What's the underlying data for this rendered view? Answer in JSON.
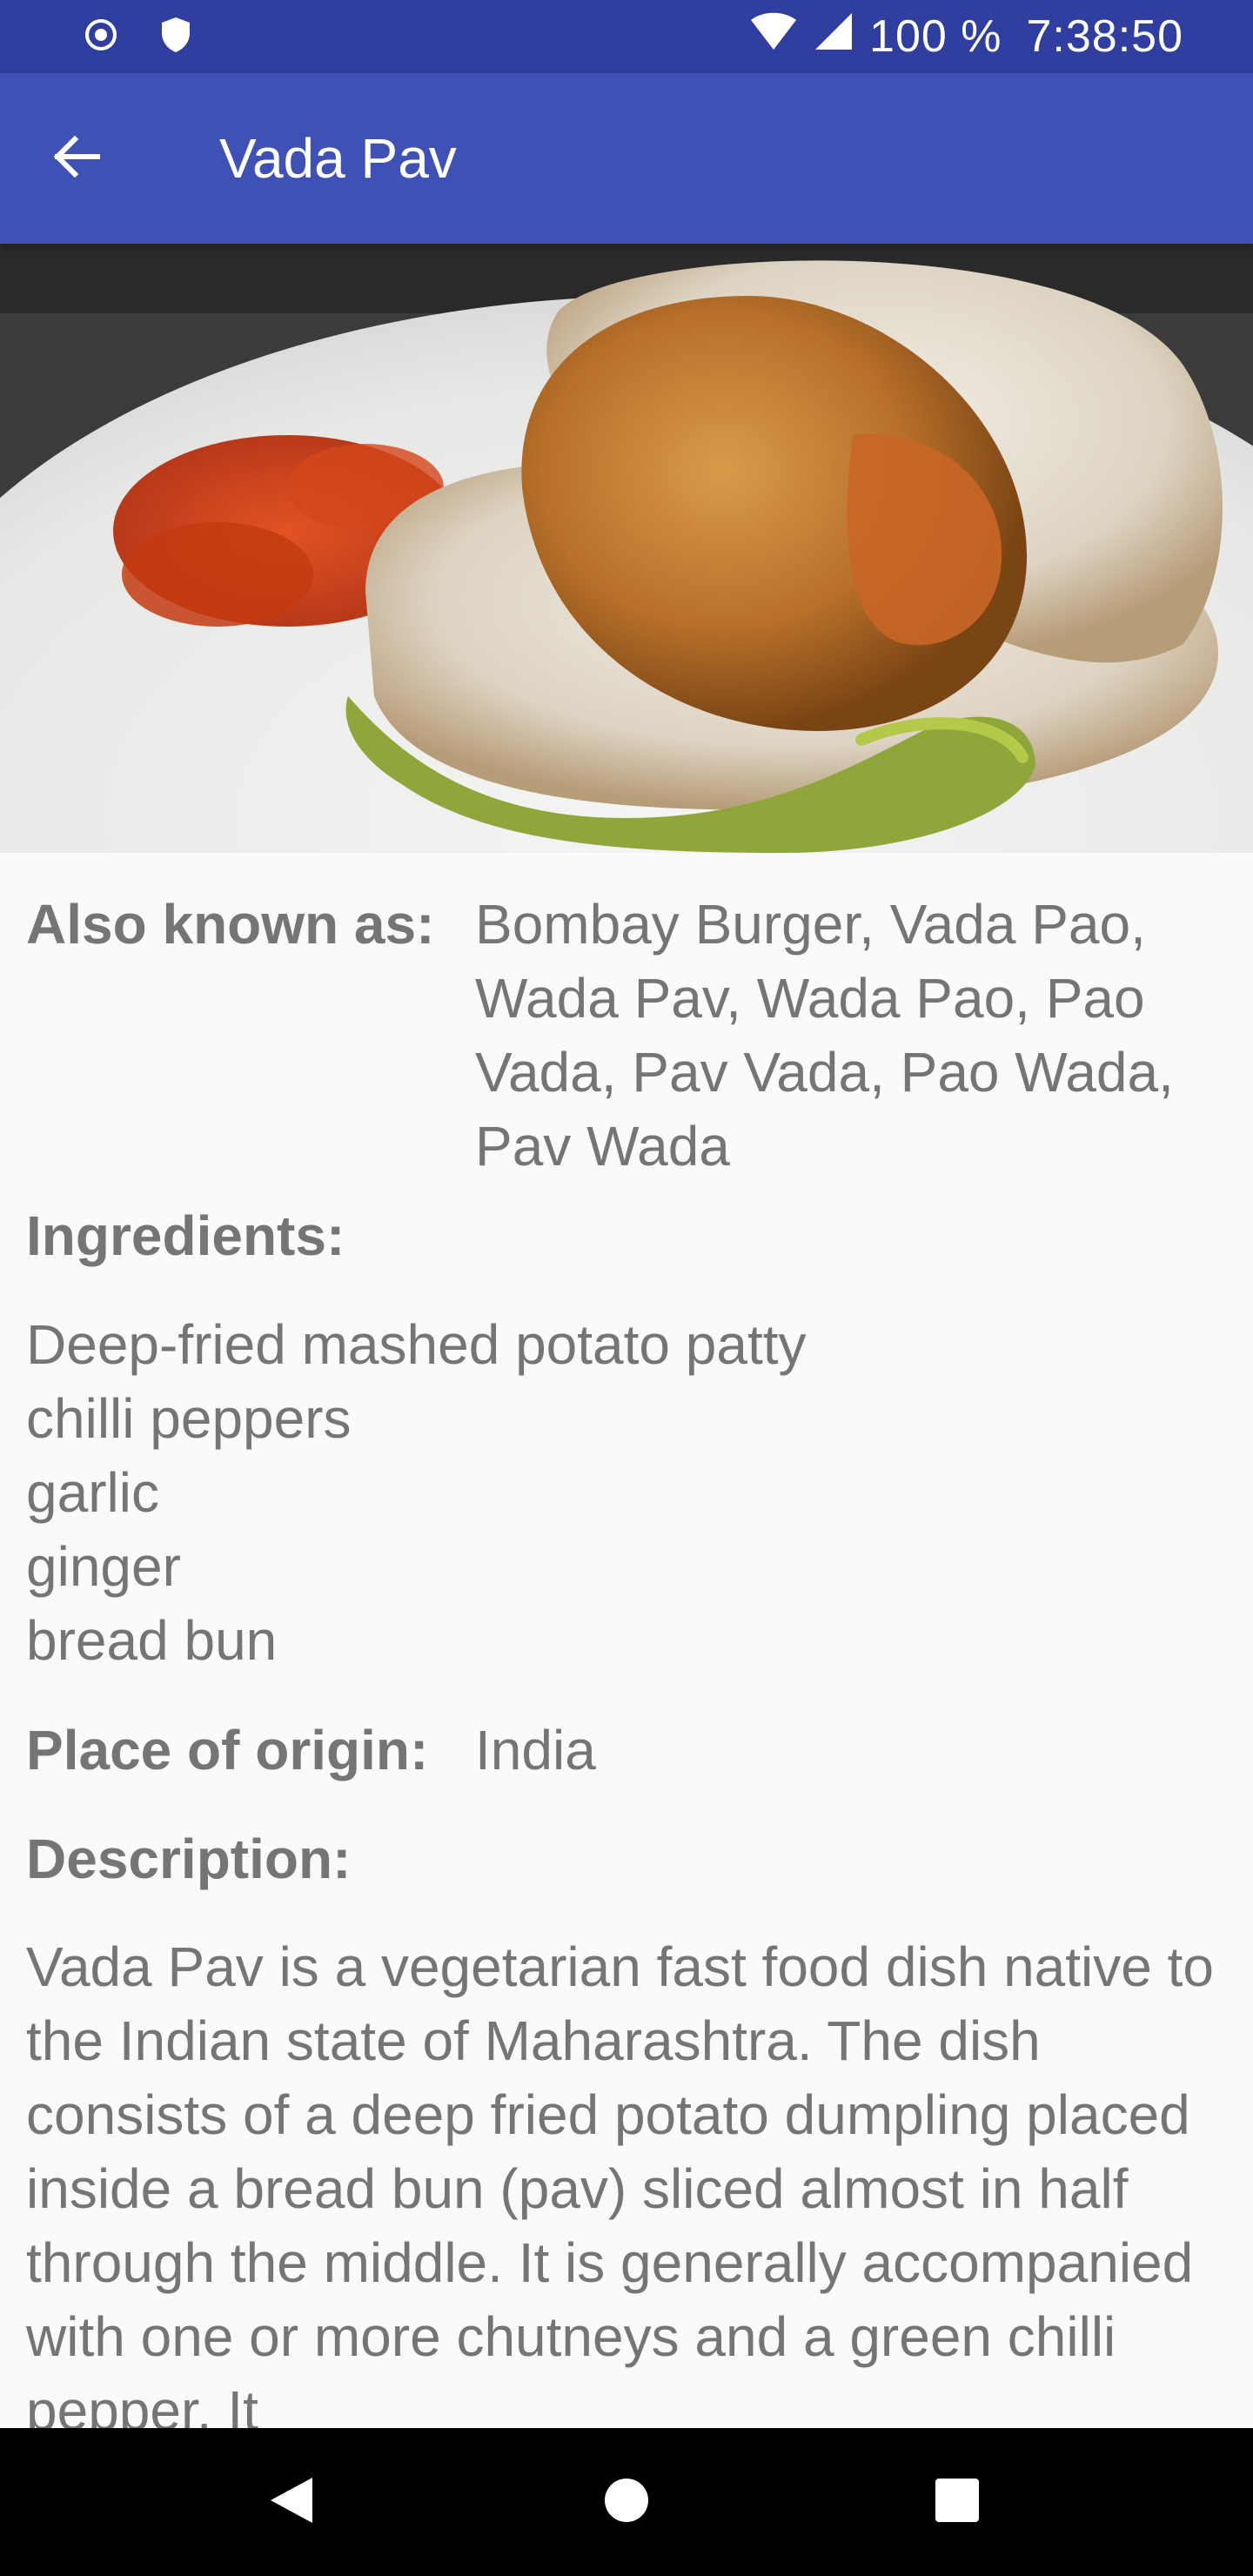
{
  "status_bar": {
    "battery_text": "100 %",
    "time": "7:38:50",
    "icons": [
      "record-icon",
      "shield-icon",
      "wifi-icon",
      "signal-icon"
    ]
  },
  "app_bar": {
    "title": "Vada Pav",
    "back_icon": "arrow-back-icon"
  },
  "hero_image": {
    "subject": "food-photo"
  },
  "details": {
    "also_known_as_label": "Also known as:",
    "also_known_as_value": "Bombay Burger, Vada Pao, Wada Pav, Wada Pao, Pao Vada, Pav Vada, Pao Wada, Pav Wada",
    "ingredients_label": "Ingredients:",
    "ingredients": [
      "Deep-fried mashed potato patty",
      "chilli peppers",
      "garlic",
      "ginger",
      "bread bun"
    ],
    "origin_label": "Place of origin:",
    "origin_value": "India",
    "description_label": "Description:",
    "description": "Vada Pav is a vegetarian fast food dish native to the Indian state of Maharashtra. The dish consists of a deep fried potato dumpling placed inside a bread bun (pav) sliced almost in half through the middle. It is generally accompanied with one or more chutneys and a green chilli pepper. It"
  },
  "nav_bar": {
    "icons": [
      "back-triangle-icon",
      "home-circle-icon",
      "recents-square-icon"
    ]
  },
  "colors": {
    "status_bar": "#303f9f",
    "app_bar": "#3f51b5",
    "text": "#757575",
    "background": "#fafafa"
  }
}
